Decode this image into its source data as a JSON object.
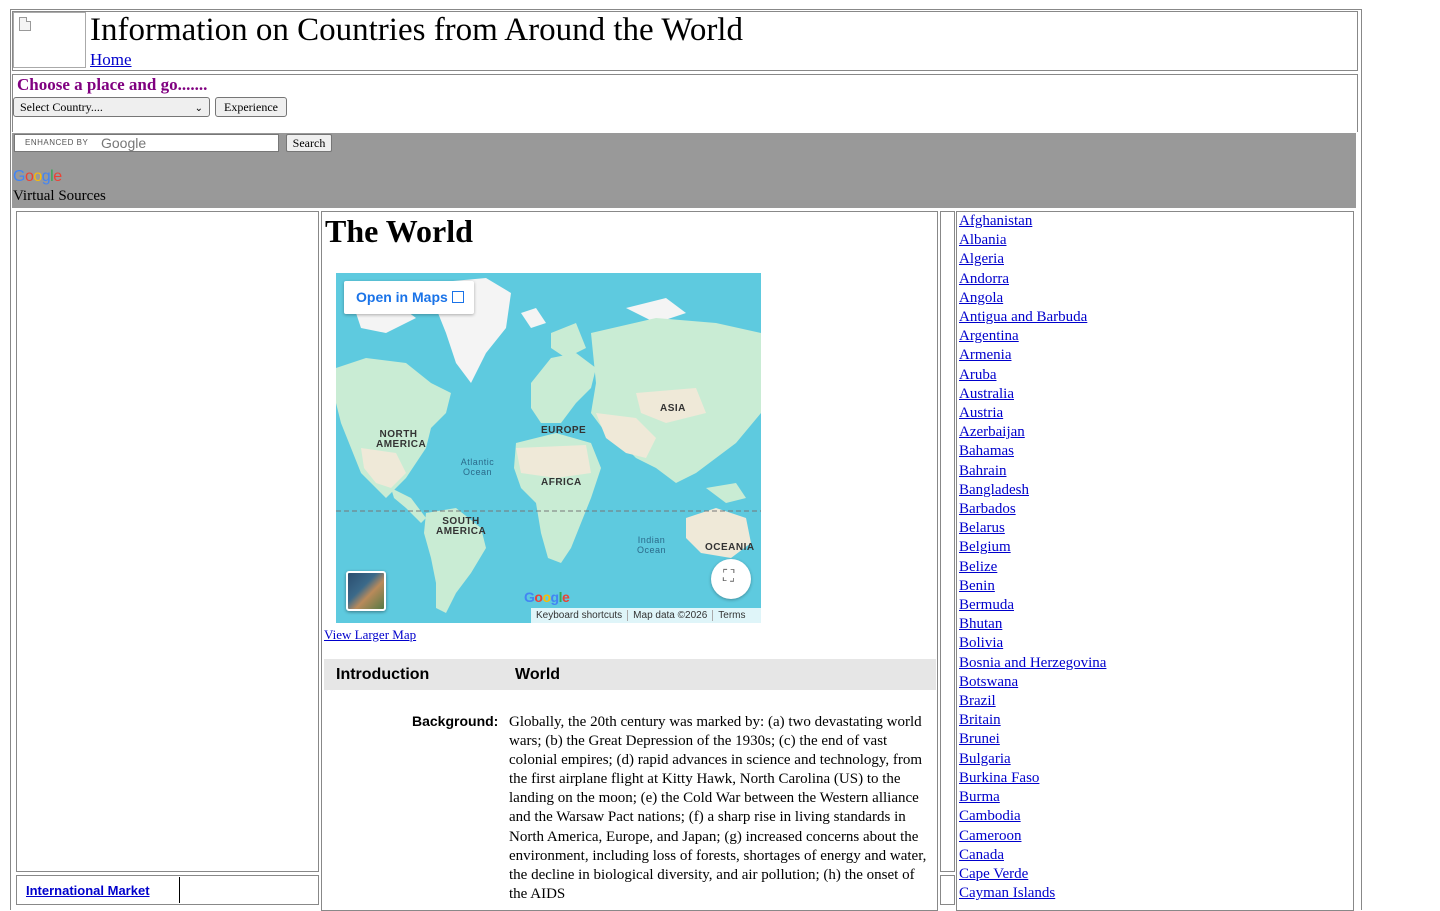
{
  "site": {
    "title": "Information on Countries from Around the World",
    "home_link": "Home"
  },
  "chooser": {
    "heading": "Choose a place and go.......",
    "select_value": "Select Country....",
    "button": "Experience"
  },
  "search": {
    "enhanced_by": "ENHANCED BY",
    "google_text": "Google",
    "button": "Search",
    "google_logo": "Google",
    "virtual_sources": "Virtual Sources"
  },
  "left_sidebar": {
    "link": "International Market"
  },
  "main": {
    "heading": "The World",
    "map": {
      "open_in_maps": "Open in Maps",
      "labels": {
        "north_america": "NORTH AMERICA",
        "south_america": "SOUTH AMERICA",
        "europe": "EUROPE",
        "asia": "ASIA",
        "africa": "AFRICA",
        "oceania": "OCEANIA",
        "atlantic": "Atlantic Ocean",
        "indian": "Indian Ocean"
      },
      "wordmark": "Google",
      "footer": {
        "shortcuts": "Keyboard shortcuts",
        "data": "Map data ©2026",
        "terms": "Terms"
      },
      "colors": {
        "ocean": "#5ecadf",
        "land": "#c9ecd4",
        "ice": "#f4f4f4",
        "desert": "#efe9d8"
      }
    },
    "larger_map": "View Larger Map",
    "intro_left": "Introduction",
    "intro_right": "World",
    "background_label": "Background:",
    "background_text": "Globally, the 20th century was marked by: (a) two devastating world wars; (b) the Great Depression of the 1930s; (c) the end of vast colonial empires; (d) rapid advances in science and technology, from the first airplane flight at Kitty Hawk, North Carolina (US) to the landing on the moon; (e) the Cold War between the Western alliance and the Warsaw Pact nations; (f) a sharp rise in living standards in North America, Europe, and Japan; (g) increased concerns about the environment, including loss of forests, shortages of energy and water, the decline in biological diversity, and air pollution; (h) the onset of the AIDS"
  },
  "countries": [
    "Afghanistan",
    "Albania",
    "Algeria",
    "Andorra",
    "Angola",
    "Antigua and Barbuda",
    "Argentina",
    "Armenia",
    "Aruba",
    "Australia",
    "Austria",
    "Azerbaijan",
    "Bahamas",
    "Bahrain",
    "Bangladesh",
    "Barbados",
    "Belarus",
    "Belgium",
    "Belize",
    "Benin",
    "Bermuda",
    "Bhutan",
    "Bolivia",
    "Bosnia and Herzegovina",
    "Botswana",
    "Brazil",
    "Britain",
    "Brunei",
    "Bulgaria",
    "Burkina Faso",
    "Burma",
    "Cambodia",
    "Cameroon",
    "Canada",
    "Cape Verde",
    "Cayman Islands"
  ]
}
